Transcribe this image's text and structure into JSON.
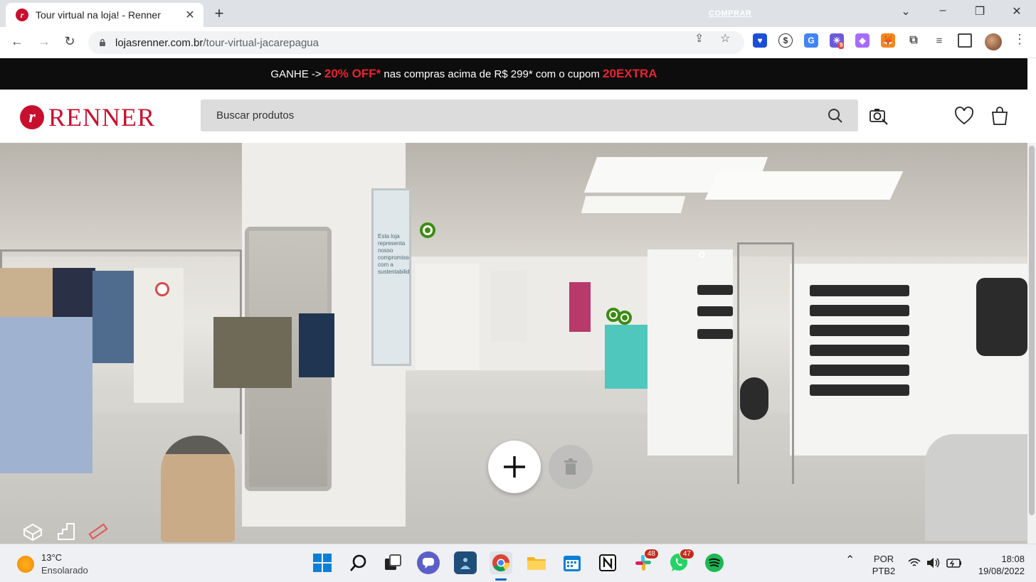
{
  "browser": {
    "tab_title": "Tour virtual na loja! - Renner",
    "tab_favicon_letter": "r",
    "url_host": "lojasrenner.com.br",
    "url_path": "/tour-virtual-jacarepagua",
    "extension_badge": "9"
  },
  "promo": {
    "text_prefix": "GANHE ->",
    "discount": "20% OFF*",
    "text_middle": "nas compras acima de R$ 299* com o cupom",
    "coupon": "20EXTRA",
    "link_label": "COMPRAR"
  },
  "header": {
    "logo_letter": "r",
    "logo_text": "RENNER",
    "search_placeholder": "Buscar produtos"
  },
  "tour": {
    "add_button_label": "+",
    "store_sign_text": "Esta loja representa nosso compromisso com a sustentabilidade"
  },
  "taskbar": {
    "weather_temp": "13°C",
    "weather_desc": "Ensolarado",
    "slack_badge": "48",
    "whatsapp_badge": "47",
    "language_line1": "POR",
    "language_line2": "PTB2",
    "time": "18:08",
    "date": "19/08/2022"
  },
  "colors": {
    "brand_red": "#c8102e",
    "promo_red": "#e8242e",
    "hotspot_green": "#3d8c12"
  }
}
